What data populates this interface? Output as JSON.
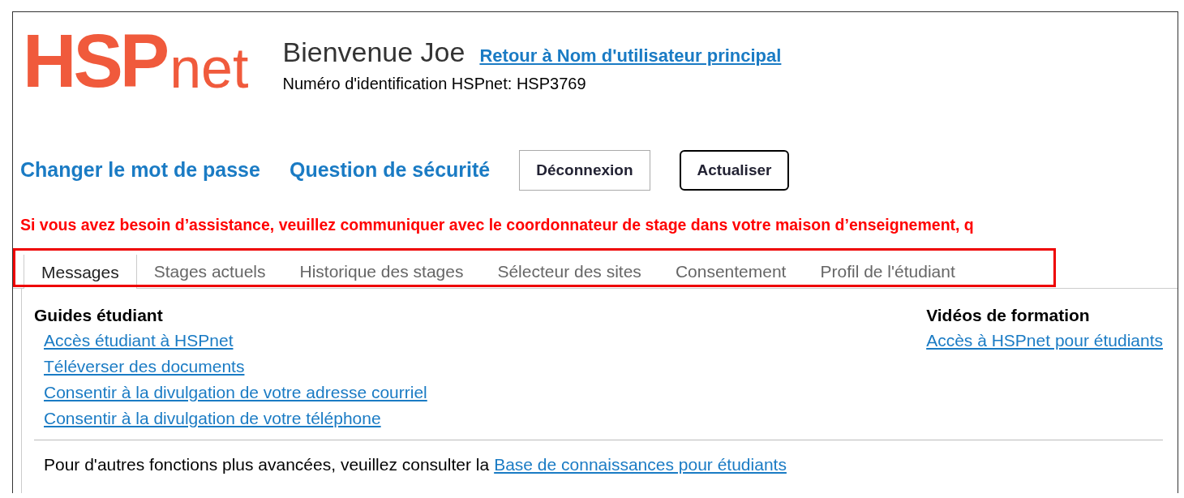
{
  "logo": {
    "part_1": "HSP",
    "part_2": "net"
  },
  "header": {
    "welcome": "Bienvenue Joe",
    "return_link": "Retour à Nom d'utilisateur principal",
    "id_line": "Numéro d'identification HSPnet: HSP3769"
  },
  "actions": {
    "links": [
      "Changer le mot de passe",
      "Question de sécurité"
    ],
    "buttons": [
      {
        "label": "Déconnexion",
        "kind": "plain"
      },
      {
        "label": "Actualiser",
        "kind": "outlined"
      }
    ]
  },
  "warning": "Si vous avez besoin d’assistance, veuillez communiquer avec le coordonnateur de stage dans votre maison d’enseignement, q",
  "tabs": [
    {
      "label": "Messages",
      "selected": true
    },
    {
      "label": "Stages actuels",
      "selected": false
    },
    {
      "label": "Historique des stages",
      "selected": false
    },
    {
      "label": "Sélecteur des sites",
      "selected": false
    },
    {
      "label": "Consentement",
      "selected": false
    },
    {
      "label": "Profil de l'étudiant",
      "selected": false
    }
  ],
  "guides": {
    "title": "Guides étudiant",
    "links": [
      "Accès étudiant à HSPnet",
      "Téléverser des documents",
      "Consentir à la divulgation de votre adresse courriel",
      "Consentir à la divulgation de votre téléphone"
    ]
  },
  "videos": {
    "title": "Vidéos de formation",
    "links": [
      "Accès à HSPnet pour étudiants"
    ]
  },
  "footer": {
    "text": "Pour d'autres fonctions plus avancées, veuillez consulter la",
    "link": "Base de connaissances pour étudiants"
  }
}
